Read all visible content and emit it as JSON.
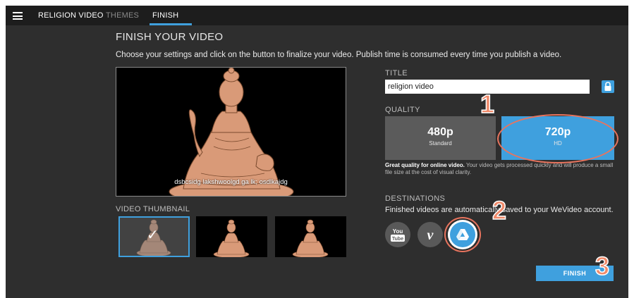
{
  "topbar": {
    "menu_icon": "hamburger-menu-icon",
    "project_name": "RELIGION VIDEO",
    "tabs": [
      {
        "label": "THEMES",
        "active": false
      },
      {
        "label": "FINISH",
        "active": true
      }
    ]
  },
  "page": {
    "title": "FINISH YOUR VIDEO",
    "description": "Choose your settings and click on the button to finalize your video. Publish time is consumed every time you publish a video."
  },
  "preview": {
    "caption": "dsbcsidg lakshwoolgd ga lk; osdlkajdg"
  },
  "thumbnails": {
    "label": "VIDEO THUMBNAIL",
    "selected_icon": "checkmark-icon"
  },
  "title_field": {
    "label": "TITLE",
    "value": "religion video",
    "lock_icon": "lock-icon"
  },
  "quality": {
    "label": "QUALITY",
    "options": [
      {
        "main": "480p",
        "sub": "Standard",
        "selected": false
      },
      {
        "main": "720p",
        "sub": "HD",
        "selected": true
      }
    ],
    "description_bold": "Great quality for online video.",
    "description_rest": " Your video gets processed quickly and will produce a small file size at the cost of visual clarity."
  },
  "destinations": {
    "label": "DESTINATIONS",
    "description": "Finished videos are automatically saved to your WeVideo account.",
    "icons": [
      "youtube-icon",
      "vimeo-icon",
      "google-drive-icon"
    ],
    "youtube_text_top": "You",
    "youtube_text_bottom": "Tube",
    "vimeo_text": "v"
  },
  "finish_button": {
    "label": "FINISH"
  },
  "annotations": [
    "1",
    "2",
    "3"
  ],
  "colors": {
    "accent": "#3fa0de",
    "annotation": "#e8745e",
    "panel_bg": "#2e2e2e",
    "topbar_bg": "#1d1d1d"
  }
}
